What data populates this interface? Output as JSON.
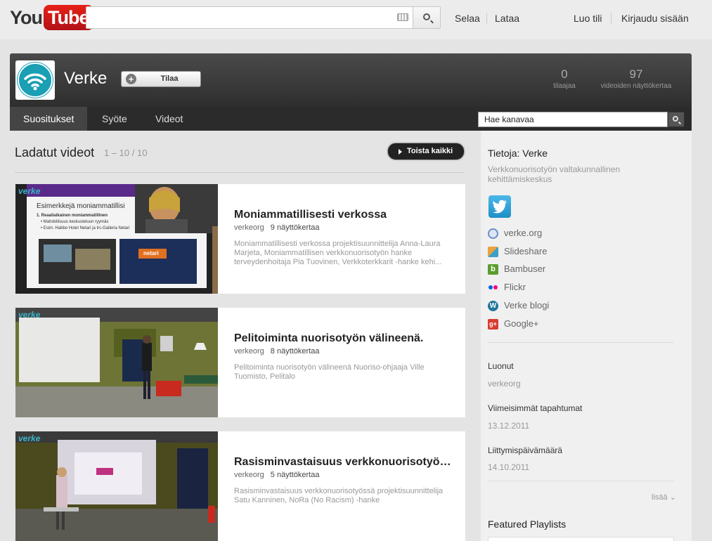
{
  "topbar": {
    "logo_you": "You",
    "logo_tube": "Tube",
    "search_value": "",
    "browse": "Selaa",
    "upload": "Lataa",
    "create_account": "Luo tili",
    "sign_in": "Kirjaudu sisään"
  },
  "channel": {
    "name": "Verke",
    "subscribe": "Tilaa",
    "subscribers_count": "0",
    "subscribers_label": "tilaajaa",
    "views_count": "97",
    "views_label": "videoiden näyttökertaa",
    "tabs": [
      "Suositukset",
      "Syöte",
      "Videot"
    ],
    "search_placeholder": "Hae kanavaa"
  },
  "uploads": {
    "title": "Ladatut videot",
    "count": "1 – 10 / 10",
    "play_all": "Toista kaikki",
    "videos": [
      {
        "title": "Moniammatillisesti verkossa",
        "user": "verkeorg",
        "views": "9 näyttökertaa",
        "description": "Moniammatillisesti verkossa projektisuunnittelija Anna-Laura Marjeta, Moniammatillisen verkkonuorisotyön hanke terveydenhoitaja Pia Tuovinen, Verkkoterkkarit -hanke kehi...",
        "slide_heading": "Esimerkkejä moniammatillisi",
        "slide_items": [
          "1. Reaaliaikainen moniammatillinen",
          "• Mahdollisuus keskusteluun ryymäs",
          "• Esim. Habbo Hotel Netari ja Irc-Galleria Netari"
        ],
        "slide_logo": "netari"
      },
      {
        "title": "Pelitoiminta nuorisotyön välineenä.",
        "user": "verkeorg",
        "views": "8 näyttökertaa",
        "description": "Pelitoiminta nuorisotyön välineenä Nuoriso-ohjaaja Ville Tuomisto, Pelitalo"
      },
      {
        "title": "Rasisminvastaisuus verkkonuorisotyössä",
        "user": "verkeorg",
        "views": "5 näyttökertaa",
        "description": "Rasisminvastaisuus verkkonuorisotyössä projektisuunnittelija Satu Kanninen, NoRa (No Racism) -hanke"
      }
    ],
    "overlay_brand": "verke"
  },
  "about": {
    "title": "Tietoja: Verke",
    "description": "Verkkonuorisotyön valtakunnallinen kehittämiskeskus",
    "links": [
      {
        "label": "verke.org",
        "icon": "globe-icon",
        "color": "#6a8fc7"
      },
      {
        "label": "Slideshare",
        "icon": "slideshare-icon",
        "color": "#e8a33d"
      },
      {
        "label": "Bambuser",
        "icon": "bambuser-icon",
        "color": "#5a9e2f"
      },
      {
        "label": "Flickr",
        "icon": "flickr-icon",
        "color": "#ff0084"
      },
      {
        "label": "Verke blogi",
        "icon": "wordpress-icon",
        "color": "#21759b"
      },
      {
        "label": "Google+",
        "icon": "googleplus-icon",
        "color": "#d73d32"
      }
    ],
    "created_label": "Luonut",
    "created_value": "verkeorg",
    "latest_label": "Viimeisimmät tapahtumat",
    "latest_value": "13.12.2011",
    "joined_label": "Liittymispäivämäärä",
    "joined_value": "14.10.2011",
    "more": "lisää",
    "featured_playlists": "Featured Playlists"
  },
  "colors": {
    "youtube_red": "#cc181e",
    "verke_teal": "#1a9fb4",
    "header_dark": "#2e2e2e"
  }
}
